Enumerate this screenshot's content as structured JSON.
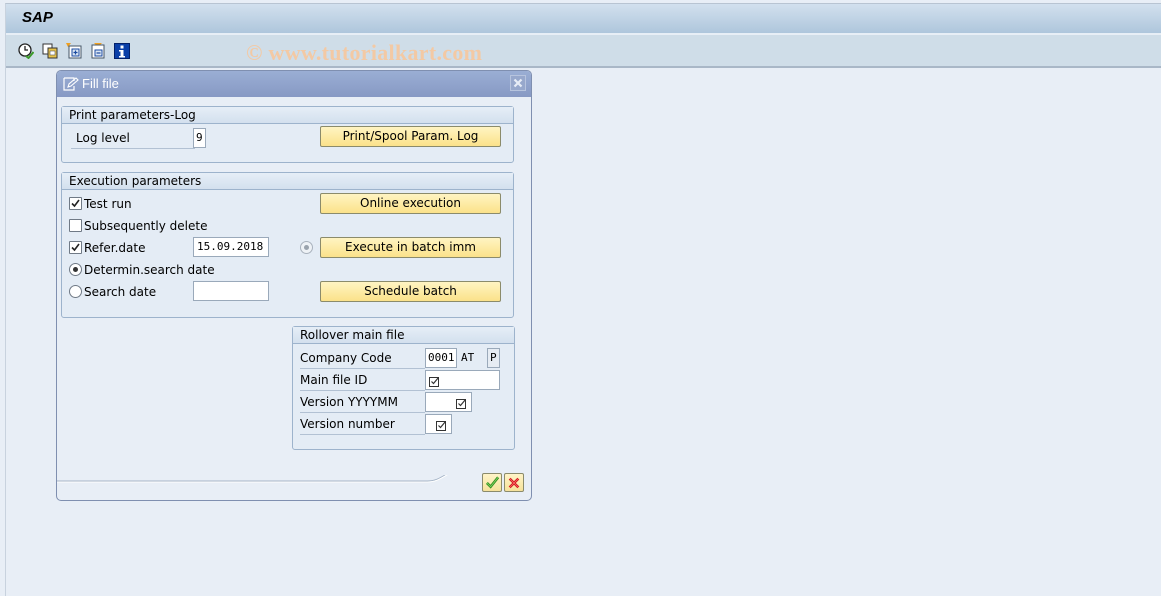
{
  "app": {
    "title": "SAP",
    "watermark": "© www.tutorialkart.com"
  },
  "toolbar": {
    "icons": [
      {
        "name": "execute-clock-icon",
        "tooltip": ""
      },
      {
        "name": "copy-variant-icon",
        "tooltip": ""
      },
      {
        "name": "expand-all-icon",
        "tooltip": ""
      },
      {
        "name": "collapse-all-icon",
        "tooltip": ""
      },
      {
        "name": "info-icon",
        "tooltip": ""
      }
    ]
  },
  "dialog": {
    "title": "Fill file",
    "close_icon": "close-icon",
    "print_params": {
      "heading": "Print parameters-Log",
      "log_level_label": "Log level",
      "log_level_value": "9",
      "print_button": "Print/Spool Param. Log"
    },
    "execution": {
      "heading": "Execution parameters",
      "test_run_label": "Test run",
      "test_run_checked": true,
      "subsequently_delete_label": "Subsequently delete",
      "subsequently_delete_checked": false,
      "refer_date_label": "Refer.date",
      "refer_date_checked": true,
      "refer_date_value": "15.09.2018",
      "determin_search_date_label": "Determin.search date",
      "determin_search_date_selected": true,
      "search_date_label": "Search date",
      "search_date_selected": false,
      "search_date_value": "",
      "online_execution_button": "Online execution",
      "execute_batch_imm_button": "Execute in batch imm",
      "schedule_batch_button": "Schedule batch"
    },
    "rollover": {
      "heading": "Rollover main file",
      "company_code_label": "Company Code",
      "company_code_value": "0001",
      "company_code_country": "AT",
      "company_code_flag": "P",
      "main_file_id_label": "Main file ID",
      "main_file_id_value": "",
      "version_label": "Version YYYYMM",
      "version_value": "",
      "version_number_label": "Version number",
      "version_number_value": ""
    },
    "footer": {
      "ok_icon": "checkmark-icon",
      "cancel_icon": "cancel-icon"
    }
  },
  "colors": {
    "button_yellow": "#fbe28a",
    "dialog_header": "#8799c4",
    "watermark": "#f3c9a4",
    "ok_green": "#2e8b1e",
    "cancel_red": "#d0141a"
  }
}
